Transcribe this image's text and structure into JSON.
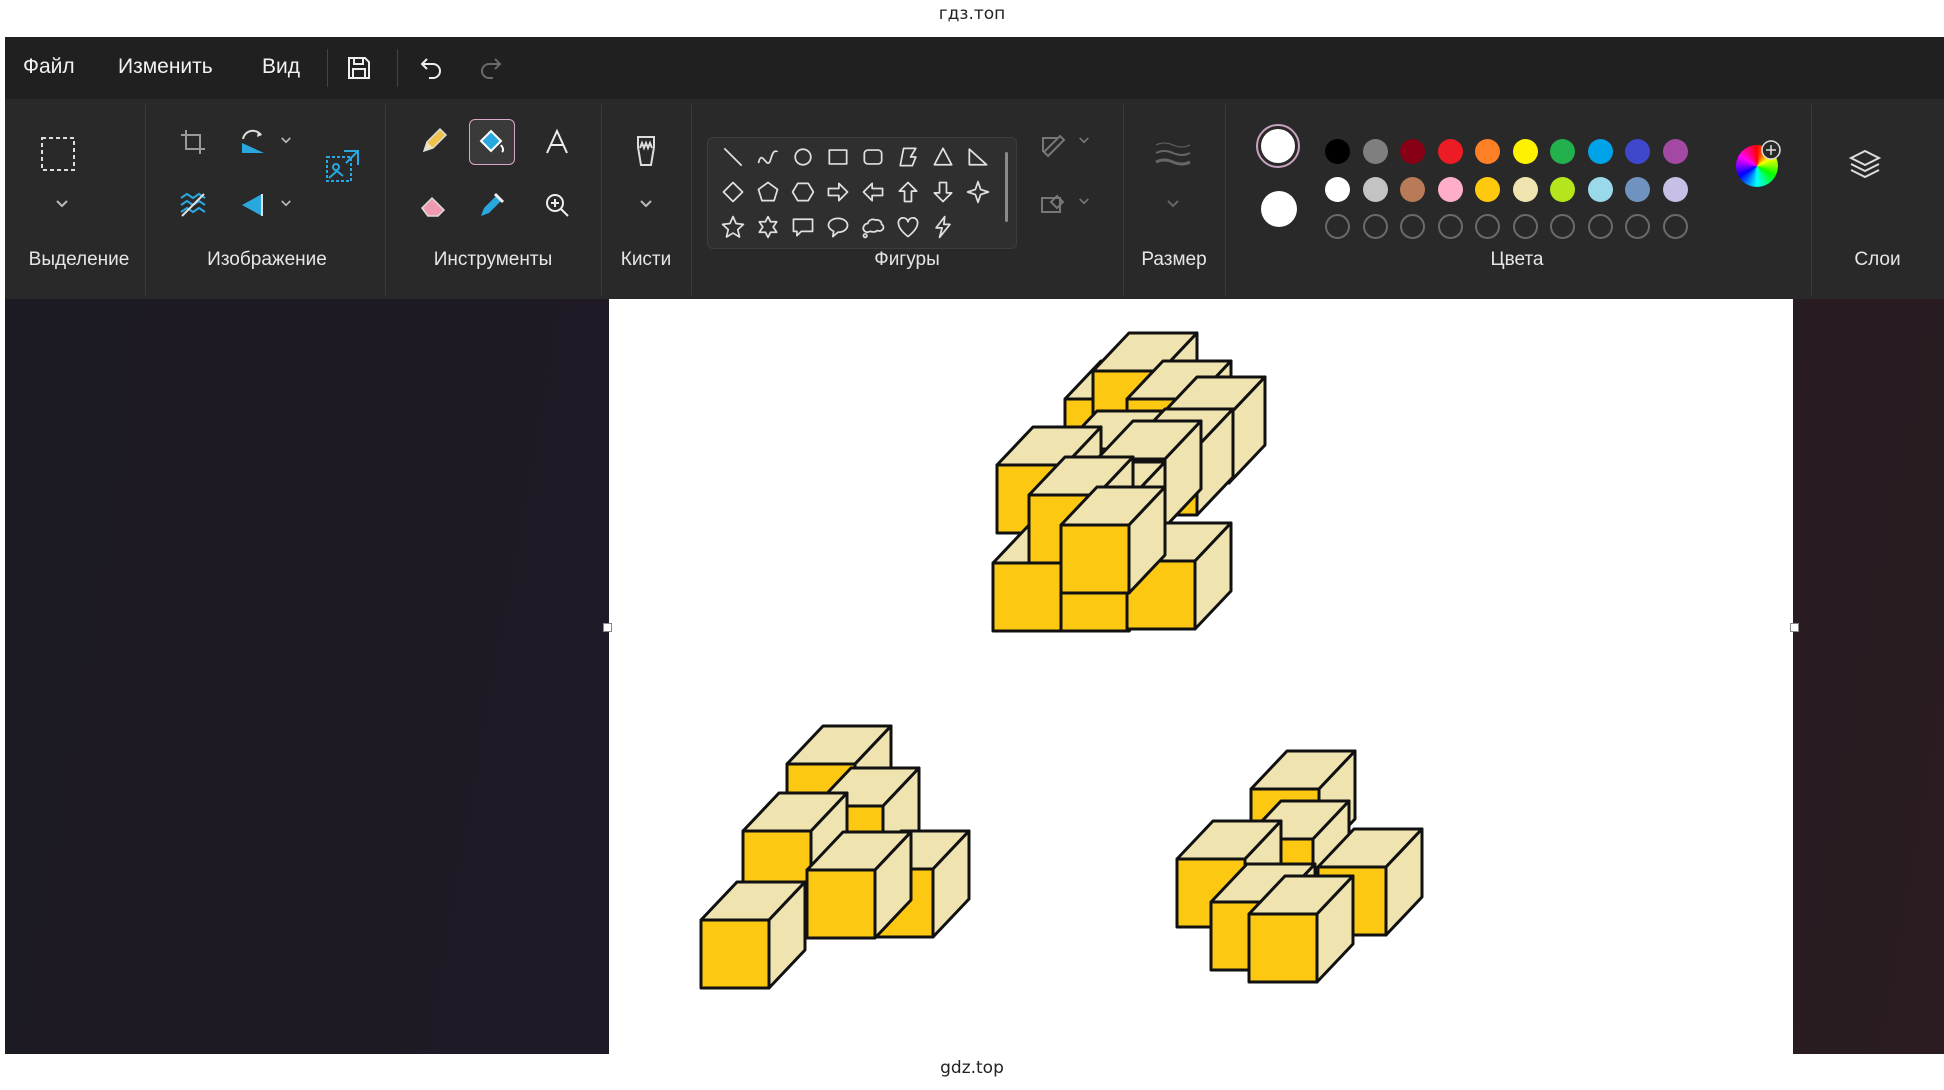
{
  "watermark": {
    "top": "гдз.топ",
    "bottom": "gdz.top"
  },
  "menu": {
    "file": "Файл",
    "edit": "Изменить",
    "view": "Вид"
  },
  "groups": {
    "selection": "Выделение",
    "image": "Изображение",
    "tools": "Инструменты",
    "brushes": "Кисти",
    "shapes": "Фигуры",
    "size": "Размер",
    "colors": "Цвета",
    "layers": "Слои"
  },
  "colors": {
    "primary": "#ffffff",
    "secondary": "#ffffff",
    "row1": [
      "#000000",
      "#7f7f7f",
      "#880015",
      "#ed1c24",
      "#ff7f27",
      "#fff200",
      "#22b14c",
      "#00a2e8",
      "#3f48cc",
      "#a349a4"
    ],
    "row2": [
      "#ffffff",
      "#c3c3c3",
      "#b97a57",
      "#ffaec9",
      "#ffc90e",
      "#efe4b0",
      "#b5e61d",
      "#99d9ea",
      "#7092be",
      "#c8bfe7"
    ]
  },
  "drawing": {
    "cube_front": "#fcc812",
    "cube_side": "#efe4b0",
    "stroke": "#111111"
  },
  "icons": [
    "save-icon",
    "undo-icon",
    "redo-icon",
    "select-icon",
    "crop-icon",
    "rotate-icon",
    "resize-icon",
    "flip-icon",
    "bg-remove-icon",
    "pencil-icon",
    "fill-icon",
    "text-icon",
    "eraser-icon",
    "color-picker-icon",
    "magnifier-icon",
    "brush-icon",
    "outline-icon",
    "shape-fill-icon",
    "size-icon",
    "edit-colors-icon",
    "layers-icon"
  ]
}
